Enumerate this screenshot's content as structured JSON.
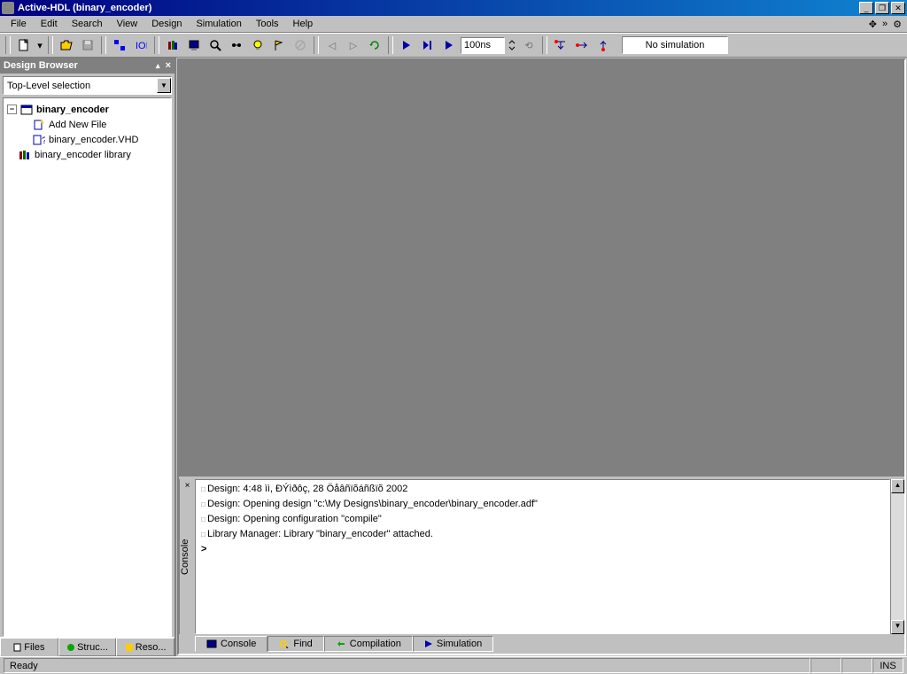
{
  "title": "Active-HDL (binary_encoder)",
  "menu": [
    "File",
    "Edit",
    "Search",
    "View",
    "Design",
    "Simulation",
    "Tools",
    "Help"
  ],
  "toolbar": {
    "time_value": "100ns",
    "sim_status": "No simulation"
  },
  "sidebar": {
    "title": "Design Browser",
    "dropdown": "Top-Level selection",
    "tree": {
      "root": "binary_encoder",
      "addnew": "Add New File",
      "file1": "binary_encoder.VHD",
      "lib": "binary_encoder library"
    },
    "tabs": [
      "Files",
      "Struc...",
      "Reso..."
    ]
  },
  "console": {
    "label": "Console",
    "lines": [
      "Design: 4:48 ìì, ÐÝìðôç, 28 Öåâñïõáñßïõ 2002",
      "Design: Opening design \"c:\\My Designs\\binary_encoder\\binary_encoder.adf\"",
      "Design: Opening configuration \"compile\"",
      "Library Manager: Library \"binary_encoder\" attached."
    ],
    "prompt": ">",
    "tabs": [
      "Console",
      "Find",
      "Compilation",
      "Simulation"
    ]
  },
  "status": {
    "ready": "Ready",
    "ins": "INS"
  }
}
